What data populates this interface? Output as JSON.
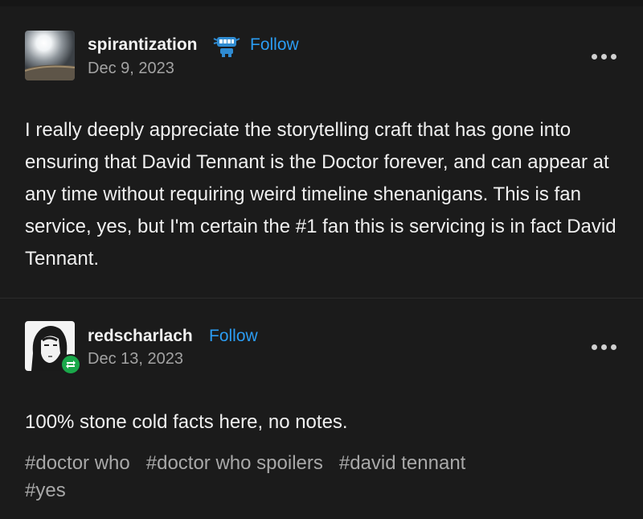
{
  "posts": [
    {
      "username": "spirantization",
      "follow_label": "Follow",
      "date": "Dec 9, 2023",
      "body": "I really deeply appreciate the storytelling craft that has gone into ensuring that David Tennant is the Doctor forever, and can appear at any time without requiring weird timeline shenanigans. This is fan service, yes, but I'm certain the #1 fan this is servicing is in fact David Tennant.",
      "badge_icon": "robot-badge-icon",
      "more_icon": "more-options-icon"
    },
    {
      "username": "redscharlach",
      "follow_label": "Follow",
      "date": "Dec 13, 2023",
      "body": "100% stone cold facts here, no notes.",
      "reblog_icon": "reblog-icon",
      "more_icon": "more-options-icon",
      "tags": [
        "#doctor who",
        "#doctor who spoilers",
        "#david tennant",
        "#yes"
      ]
    }
  ],
  "colors": {
    "background": "#1b1b1b",
    "accent": "#2b9cf2",
    "reblog_green": "#1aa84a",
    "muted_text": "#a3a3a3"
  }
}
